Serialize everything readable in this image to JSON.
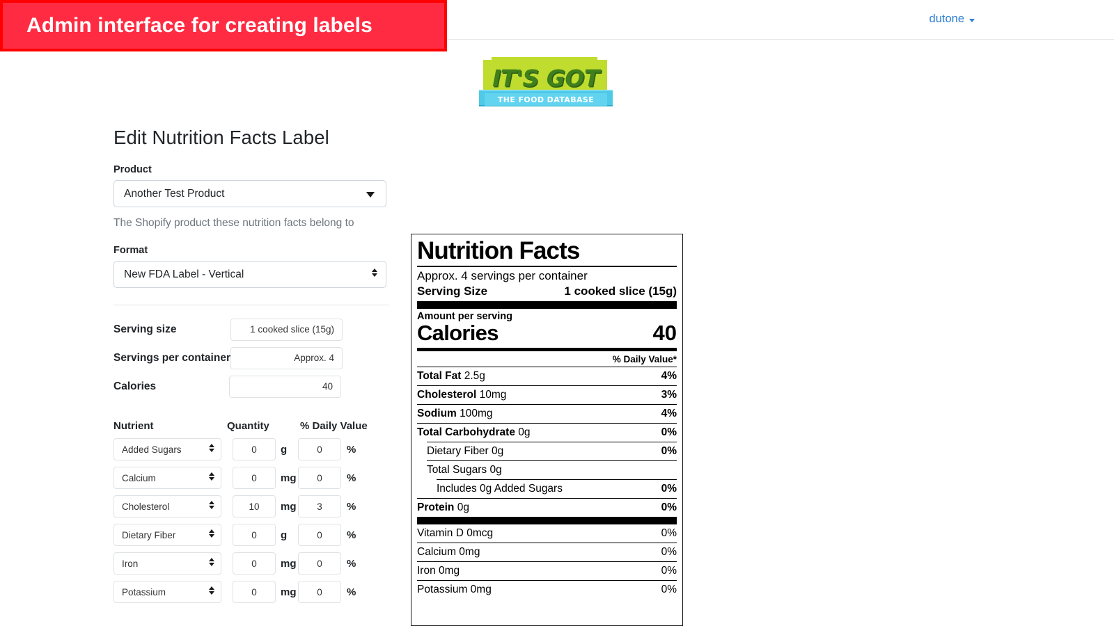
{
  "annotation": {
    "text": "Admin interface for creating labels",
    "bg_color": "#ff2b42",
    "border_color": "#ff0000"
  },
  "navbar": {
    "user": "dutone",
    "caret_icon": "chevron-down-icon"
  },
  "logo": {
    "title": "IT'S GOT",
    "subtitle": "THE FOOD DATABASE",
    "green": "#bfdc2f",
    "cyan": "#63d4ef",
    "text_green": "#3f7f1c"
  },
  "form": {
    "page_title": "Edit Nutrition Facts Label",
    "product": {
      "label": "Product",
      "value": "Another Test Product",
      "help": "The Shopify product these nutrition facts belong to",
      "icon": "chevron-down-icon"
    },
    "format": {
      "label": "Format",
      "value": "New FDA Label - Vertical",
      "icon": "stepper-icon"
    },
    "serving_size": {
      "label": "Serving size",
      "value": "1 cooked slice (15g)"
    },
    "servings_per_container": {
      "label": "Servings per container",
      "value": "Approx. 4"
    },
    "calories": {
      "label": "Calories",
      "value": "40"
    },
    "nutrient_table": {
      "headers": {
        "nutrient": "Nutrient",
        "quantity": "Quantity",
        "daily_value": "% Daily Value"
      },
      "unit_percent": "%",
      "rows": [
        {
          "nutrient": "Added Sugars",
          "quantity": "0",
          "unit": "g",
          "dv": "0"
        },
        {
          "nutrient": "Calcium",
          "quantity": "0",
          "unit": "mg",
          "dv": "0"
        },
        {
          "nutrient": "Cholesterol",
          "quantity": "10",
          "unit": "mg",
          "dv": "3"
        },
        {
          "nutrient": "Dietary Fiber",
          "quantity": "0",
          "unit": "g",
          "dv": "0"
        },
        {
          "nutrient": "Iron",
          "quantity": "0",
          "unit": "mg",
          "dv": "0"
        },
        {
          "nutrient": "Potassium",
          "quantity": "0",
          "unit": "mg",
          "dv": "0"
        }
      ]
    }
  },
  "nutrition_label": {
    "title": "Nutrition Facts",
    "servings_per_container": "Approx. 4 servings per container",
    "serving_size_label": "Serving Size",
    "serving_size_value": "1 cooked slice (15g)",
    "amount_per_serving": "Amount per serving",
    "calories_label": "Calories",
    "calories_value": "40",
    "dv_header": "% Daily Value*",
    "main_rows": [
      {
        "bold": "Total Fat",
        "rest": " 2.5g",
        "dv": "4%",
        "indent": 0
      },
      {
        "bold": "Cholesterol",
        "rest": " 10mg",
        "dv": "3%",
        "indent": 0
      },
      {
        "bold": "Sodium",
        "rest": " 100mg",
        "dv": "4%",
        "indent": 0
      },
      {
        "bold": "Total Carbohydrate",
        "rest": " 0g",
        "dv": "0%",
        "indent": 0
      },
      {
        "bold": "",
        "rest": "Dietary Fiber 0g",
        "dv": "0%",
        "indent": 1
      },
      {
        "bold": "",
        "rest": "Total Sugars 0g",
        "dv": "",
        "indent": 1
      },
      {
        "bold": "",
        "rest": "Includes 0g Added Sugars",
        "dv": "0%",
        "indent": 2
      },
      {
        "bold": "Protein",
        "rest": " 0g",
        "dv": "0%",
        "indent": 0
      }
    ],
    "vitamin_rows": [
      {
        "text": "Vitamin D 0mcg",
        "dv": "0%"
      },
      {
        "text": "Calcium 0mg",
        "dv": "0%"
      },
      {
        "text": "Iron 0mg",
        "dv": "0%"
      },
      {
        "text": "Potassium 0mg",
        "dv": "0%"
      }
    ]
  }
}
